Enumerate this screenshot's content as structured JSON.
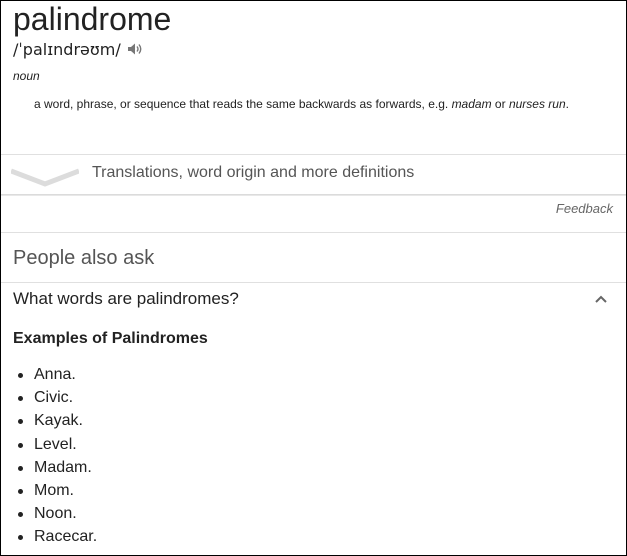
{
  "entry": {
    "word": "palindrome",
    "pronunciation": "/ˈpalɪndrəʊm/",
    "speaker_icon": "speaker-icon",
    "part_of_speech": "noun",
    "definition": {
      "text": "a word, phrase, or sequence that reads the same backwards as forwards, e.g.",
      "example_1": "madam",
      "connector": "or",
      "example_2": "nurses run",
      "end": "."
    }
  },
  "translations": {
    "label": "Translations, word origin and more definitions",
    "icon": "chevron-down-icon"
  },
  "feedback_label": "Feedback",
  "people_also_ask": {
    "title": "People also ask",
    "question": "What words are palindromes?",
    "question_icon": "chevron-up-icon",
    "answer_title": "Examples of Palindromes",
    "examples": [
      "Anna.",
      "Civic.",
      "Kayak.",
      "Level.",
      "Madam.",
      "Mom.",
      "Noon.",
      "Racecar."
    ]
  }
}
